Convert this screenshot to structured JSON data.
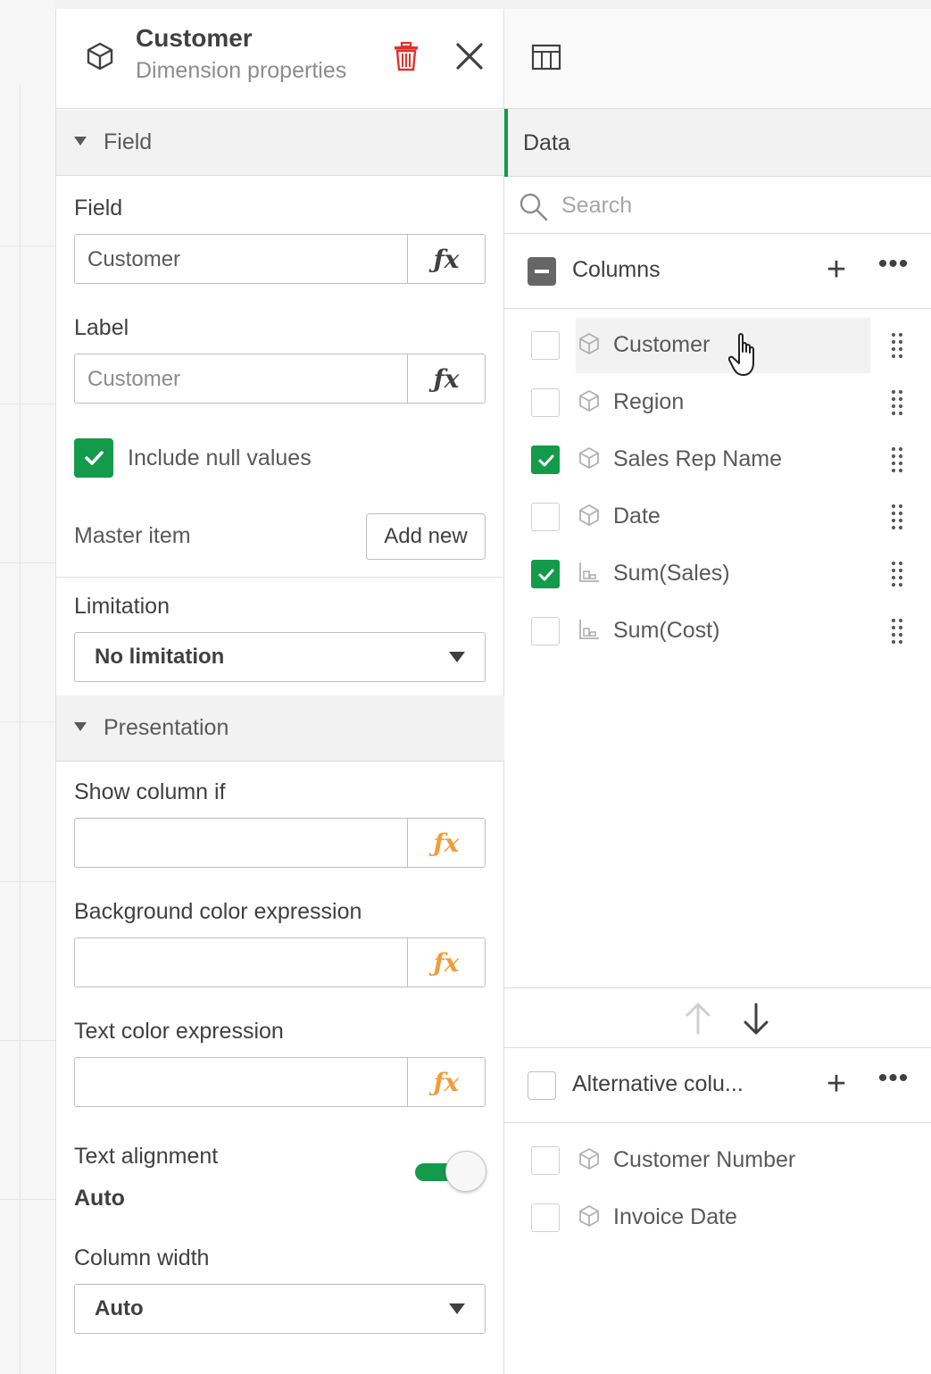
{
  "header": {
    "title": "Customer",
    "subtitle": "Dimension properties"
  },
  "sections": {
    "field": "Field",
    "presentation": "Presentation"
  },
  "field": {
    "label": "Field",
    "value": "Customer",
    "fx": "fx"
  },
  "label_field": {
    "label": "Label",
    "placeholder": "Customer",
    "fx": "fx"
  },
  "include_null": {
    "label": "Include null values",
    "checked": true
  },
  "master_item": {
    "label": "Master item",
    "button": "Add new"
  },
  "limitation": {
    "label": "Limitation",
    "value": "No limitation"
  },
  "show_column_if": {
    "label": "Show column if",
    "value": "",
    "fx": "fx"
  },
  "bg_color_expr": {
    "label": "Background color expression",
    "value": "",
    "fx": "fx"
  },
  "text_color_expr": {
    "label": "Text color expression",
    "value": "",
    "fx": "fx"
  },
  "text_alignment": {
    "label": "Text alignment",
    "value": "Auto",
    "toggle_on": true
  },
  "column_width": {
    "label": "Column width",
    "value": "Auto"
  },
  "data_panel": {
    "tab": "Data",
    "search_placeholder": "Search",
    "columns_group": "Columns",
    "columns": [
      {
        "name": "Customer",
        "checked": false,
        "type": "dimension-icon"
      },
      {
        "name": "Region",
        "checked": false,
        "type": "dimension-icon"
      },
      {
        "name": "Sales Rep Name",
        "checked": true,
        "type": "dimension-icon"
      },
      {
        "name": "Date",
        "checked": false,
        "type": "dimension-icon"
      },
      {
        "name": "Sum(Sales)",
        "checked": true,
        "type": "measure-icon"
      },
      {
        "name": "Sum(Cost)",
        "checked": false,
        "type": "measure-icon"
      }
    ],
    "alt_group": "Alternative colu...",
    "alt_columns": [
      {
        "name": "Customer Number",
        "checked": false,
        "type": "dimension-icon"
      },
      {
        "name": "Invoice Date",
        "checked": false,
        "type": "dimension-icon"
      }
    ]
  },
  "colors": {
    "accent_green": "#139a4b",
    "delete_red": "#e0302a",
    "fx_orange": "#f29d38"
  }
}
